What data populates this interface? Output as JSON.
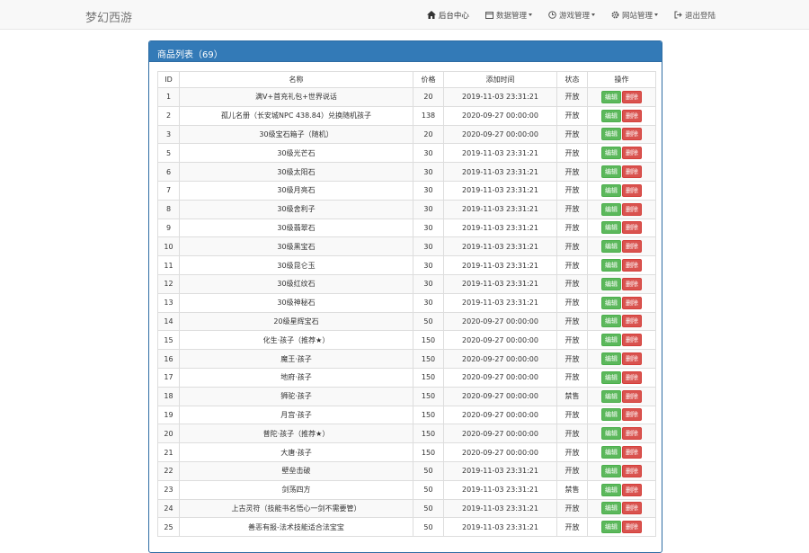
{
  "nav": {
    "brand": "梦幻西游",
    "items": [
      {
        "label": "后台中心",
        "icon": "home-icon",
        "dropdown": false
      },
      {
        "label": "数据管理",
        "icon": "list-icon",
        "dropdown": true
      },
      {
        "label": "游戏管理",
        "icon": "clock-icon",
        "dropdown": true
      },
      {
        "label": "网站管理",
        "icon": "gear-icon",
        "dropdown": true
      },
      {
        "label": "退出登陆",
        "icon": "logout-icon",
        "dropdown": false
      }
    ]
  },
  "panel": {
    "title": "商品列表（69）"
  },
  "table": {
    "headers": [
      "ID",
      "名称",
      "价格",
      "添加时间",
      "状态",
      "操作"
    ],
    "edit_label": "编辑",
    "delete_label": "删除",
    "rows": [
      {
        "id": "1",
        "name": "满V+首充礼包+世界说话",
        "price": "20",
        "time": "2019-11-03 23:31:21",
        "status": "开放"
      },
      {
        "id": "2",
        "name": "孤儿名册（长安城NPC 438.84）兑换随机孩子",
        "price": "138",
        "time": "2020-09-27 00:00:00",
        "status": "开放"
      },
      {
        "id": "3",
        "name": "30级宝石箱子（随机）",
        "price": "20",
        "time": "2020-09-27 00:00:00",
        "status": "开放"
      },
      {
        "id": "5",
        "name": "30级光芒石",
        "price": "30",
        "time": "2019-11-03 23:31:21",
        "status": "开放"
      },
      {
        "id": "6",
        "name": "30级太阳石",
        "price": "30",
        "time": "2019-11-03 23:31:21",
        "status": "开放"
      },
      {
        "id": "7",
        "name": "30级月亮石",
        "price": "30",
        "time": "2019-11-03 23:31:21",
        "status": "开放"
      },
      {
        "id": "8",
        "name": "30级舍利子",
        "price": "30",
        "time": "2019-11-03 23:31:21",
        "status": "开放"
      },
      {
        "id": "9",
        "name": "30级翡翠石",
        "price": "30",
        "time": "2019-11-03 23:31:21",
        "status": "开放"
      },
      {
        "id": "10",
        "name": "30级黑宝石",
        "price": "30",
        "time": "2019-11-03 23:31:21",
        "status": "开放"
      },
      {
        "id": "11",
        "name": "30级昆仑玉",
        "price": "30",
        "time": "2019-11-03 23:31:21",
        "status": "开放"
      },
      {
        "id": "12",
        "name": "30级红纹石",
        "price": "30",
        "time": "2019-11-03 23:31:21",
        "status": "开放"
      },
      {
        "id": "13",
        "name": "30级神秘石",
        "price": "30",
        "time": "2019-11-03 23:31:21",
        "status": "开放"
      },
      {
        "id": "14",
        "name": "20级星辉宝石",
        "price": "50",
        "time": "2020-09-27 00:00:00",
        "status": "开放"
      },
      {
        "id": "15",
        "name": "化生·孩子（推荐★）",
        "price": "150",
        "time": "2020-09-27 00:00:00",
        "status": "开放"
      },
      {
        "id": "16",
        "name": "魔王·孩子",
        "price": "150",
        "time": "2020-09-27 00:00:00",
        "status": "开放"
      },
      {
        "id": "17",
        "name": "地府·孩子",
        "price": "150",
        "time": "2020-09-27 00:00:00",
        "status": "开放"
      },
      {
        "id": "18",
        "name": "狮驼·孩子",
        "price": "150",
        "time": "2020-09-27 00:00:00",
        "status": "禁售"
      },
      {
        "id": "19",
        "name": "月宫·孩子",
        "price": "150",
        "time": "2020-09-27 00:00:00",
        "status": "开放"
      },
      {
        "id": "20",
        "name": "普陀·孩子（推荐★）",
        "price": "150",
        "time": "2020-09-27 00:00:00",
        "status": "开放"
      },
      {
        "id": "21",
        "name": "大唐·孩子",
        "price": "150",
        "time": "2020-09-27 00:00:00",
        "status": "开放"
      },
      {
        "id": "22",
        "name": "壁垒击破",
        "price": "50",
        "time": "2019-11-03 23:31:21",
        "status": "开放"
      },
      {
        "id": "23",
        "name": "剑荡四方",
        "price": "50",
        "time": "2019-11-03 23:31:21",
        "status": "禁售"
      },
      {
        "id": "24",
        "name": "上古灵符（技能书名悟心一剑不需要管）",
        "price": "50",
        "time": "2019-11-03 23:31:21",
        "status": "开放"
      },
      {
        "id": "25",
        "name": "善恶有报-法术技能适合法宝宝",
        "price": "50",
        "time": "2019-11-03 23:31:21",
        "status": "开放"
      }
    ]
  }
}
